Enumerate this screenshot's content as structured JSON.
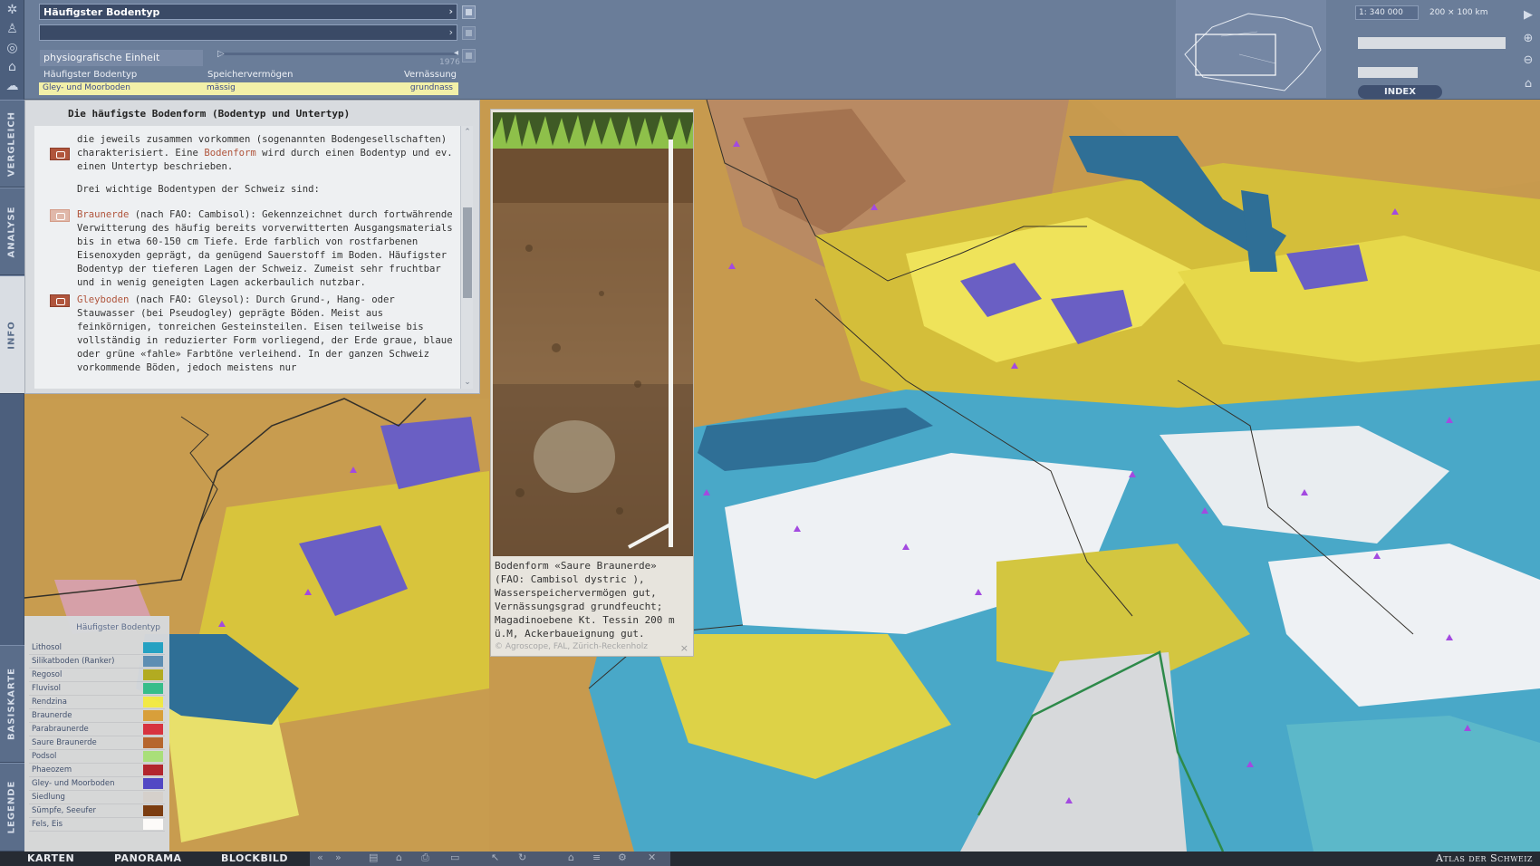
{
  "theme": {
    "title": "Häufigster Bodentyp",
    "unit_label": "physiografische Einheit",
    "year": "1976"
  },
  "attributes": {
    "headers": [
      "Häufigster Bodentyp",
      "Speichervermögen",
      "Vernässung"
    ],
    "values": [
      "Gley- und Moorboden",
      "mässig",
      "grundnass"
    ]
  },
  "scale": {
    "prefix": "1:",
    "value": "340 000",
    "extent": "200 × 100 km",
    "index_label": "INDEX"
  },
  "rail_tabs": [
    "VERGLEICH",
    "ANALYSE",
    "INFO",
    "BASISKARTE",
    "LEGENDE"
  ],
  "info": {
    "title": "Die häufigste Bodenform (Bodentyp und Untertyp)",
    "p1_before": "die jeweils zusammen vorkommen (sogenannten Bodengesellschaften) charakterisiert. Eine ",
    "p1_link": "Bodenform",
    "p1_after": " wird durch einen Bodentyp und ev. einen Untertyp beschrieben.",
    "p2": "Drei wichtige Bodentypen der Schweiz sind:",
    "p3_link": "Braunerde",
    "p3_text": " (nach FAO: Cambisol): Gekennzeichnet durch fortwährende Verwitterung des häufig bereits vorverwitterten Ausgangsmaterials bis in etwa 60-150 cm Tiefe. Erde farblich von rostfarbenen Eisenoxyden geprägt, da genügend Sauerstoff im Boden. Häufigster Bodentyp der tieferen Lagen der Schweiz. Zumeist sehr fruchtbar und in wenig geneigten Lagen ackerbaulich nutzbar.",
    "p4_link": "Gleyboden",
    "p4_text": " (nach FAO: Gleysol): Durch Grund-, Hang- oder Stauwasser (bei Pseudogley) geprägte Böden. Meist aus feinkörnigen, tonreichen Gesteinsteilen. Eisen teilweise bis vollständig in reduzierter Form vorliegend, der Erde graue, blaue oder grüne «fahle» Farbtöne verleihend. In der ganzen Schweiz vorkommende Böden, jedoch meistens nur"
  },
  "photo": {
    "caption": "Bodenform «Saure Braunerde» (FAO: Cambisol dystric ), Wasserspeichervermögen gut, Vernässungsgrad grundfeucht; Magadinoebene Kt. Tessin 200 m ü.M, Ackerbaueignung gut.",
    "credit": "© Agroscope, FAL, Zürich-Reckenholz",
    "close": "×"
  },
  "legend": {
    "title": "Häufigster Bodentyp",
    "items": [
      {
        "label": "Lithosol",
        "color": "#25a3c4"
      },
      {
        "label": "Silikatboden (Ranker)",
        "color": "#5f8fb4"
      },
      {
        "label": "Regosol",
        "color": "#b7ad1e"
      },
      {
        "label": "Fluvisol",
        "color": "#37c08a"
      },
      {
        "label": "Rendzina",
        "color": "#f4ec46"
      },
      {
        "label": "Braunerde",
        "color": "#d9a03a"
      },
      {
        "label": "Parabraunerde",
        "color": "#d8303f"
      },
      {
        "label": "Saure Braunerde",
        "color": "#b6652d"
      },
      {
        "label": "Podsol",
        "color": "#a9e27b"
      },
      {
        "label": "Phaeozem",
        "color": "#b2232c"
      },
      {
        "label": "Gley- und Moorboden",
        "color": "#4f46c8"
      },
      {
        "label": "Siedlung",
        "color": "#d6d2cf"
      },
      {
        "label": "Sümpfe, Seeufer",
        "color": "#7a3a10"
      },
      {
        "label": "Fels, Eis",
        "color": "#ffffff"
      }
    ]
  },
  "bottom_nav": [
    "KARTEN",
    "PANORAMA",
    "BLOCKBILD"
  ],
  "brand": "Atlas der Schweiz",
  "colors": {
    "lake": "#2f6f96",
    "ui_dark": "#3a4a66",
    "highlight_value": "#f2f0a8",
    "link": "#b0553c"
  }
}
